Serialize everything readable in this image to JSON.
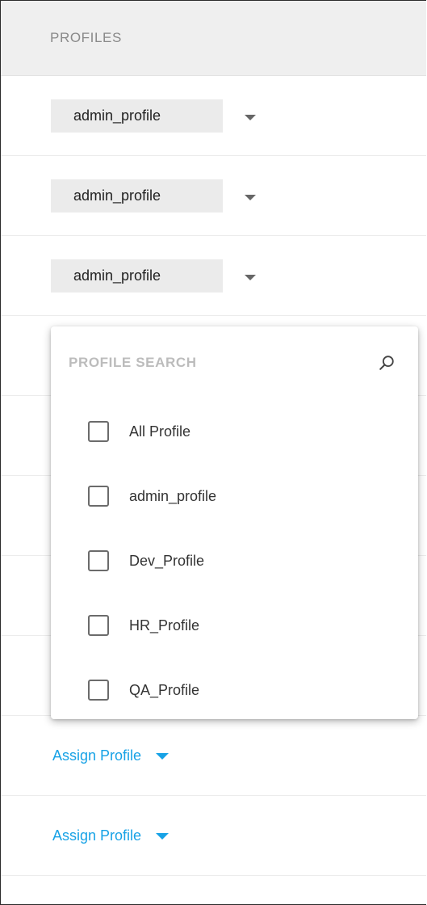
{
  "header": {
    "title": "PROFILES"
  },
  "rows": [
    {
      "type": "chip",
      "label": "admin_profile"
    },
    {
      "type": "chip",
      "label": "admin_profile"
    },
    {
      "type": "chip",
      "label": "admin_profile"
    },
    {
      "type": "empty"
    },
    {
      "type": "empty"
    },
    {
      "type": "empty"
    },
    {
      "type": "empty"
    },
    {
      "type": "empty"
    },
    {
      "type": "assign",
      "label": "Assign Profile"
    },
    {
      "type": "assign",
      "label": "Assign Profile"
    }
  ],
  "dropdown": {
    "search": {
      "placeholder": "PROFILE SEARCH",
      "value": ""
    },
    "options": [
      {
        "label": "All Profile",
        "checked": false
      },
      {
        "label": "admin_profile",
        "checked": false
      },
      {
        "label": "Dev_Profile",
        "checked": false
      },
      {
        "label": "HR_Profile",
        "checked": false
      },
      {
        "label": "QA_Profile",
        "checked": false
      }
    ]
  },
  "colors": {
    "accent": "#17a2e6",
    "chip_bg": "#ebebeb",
    "header_bg": "#efefef"
  }
}
